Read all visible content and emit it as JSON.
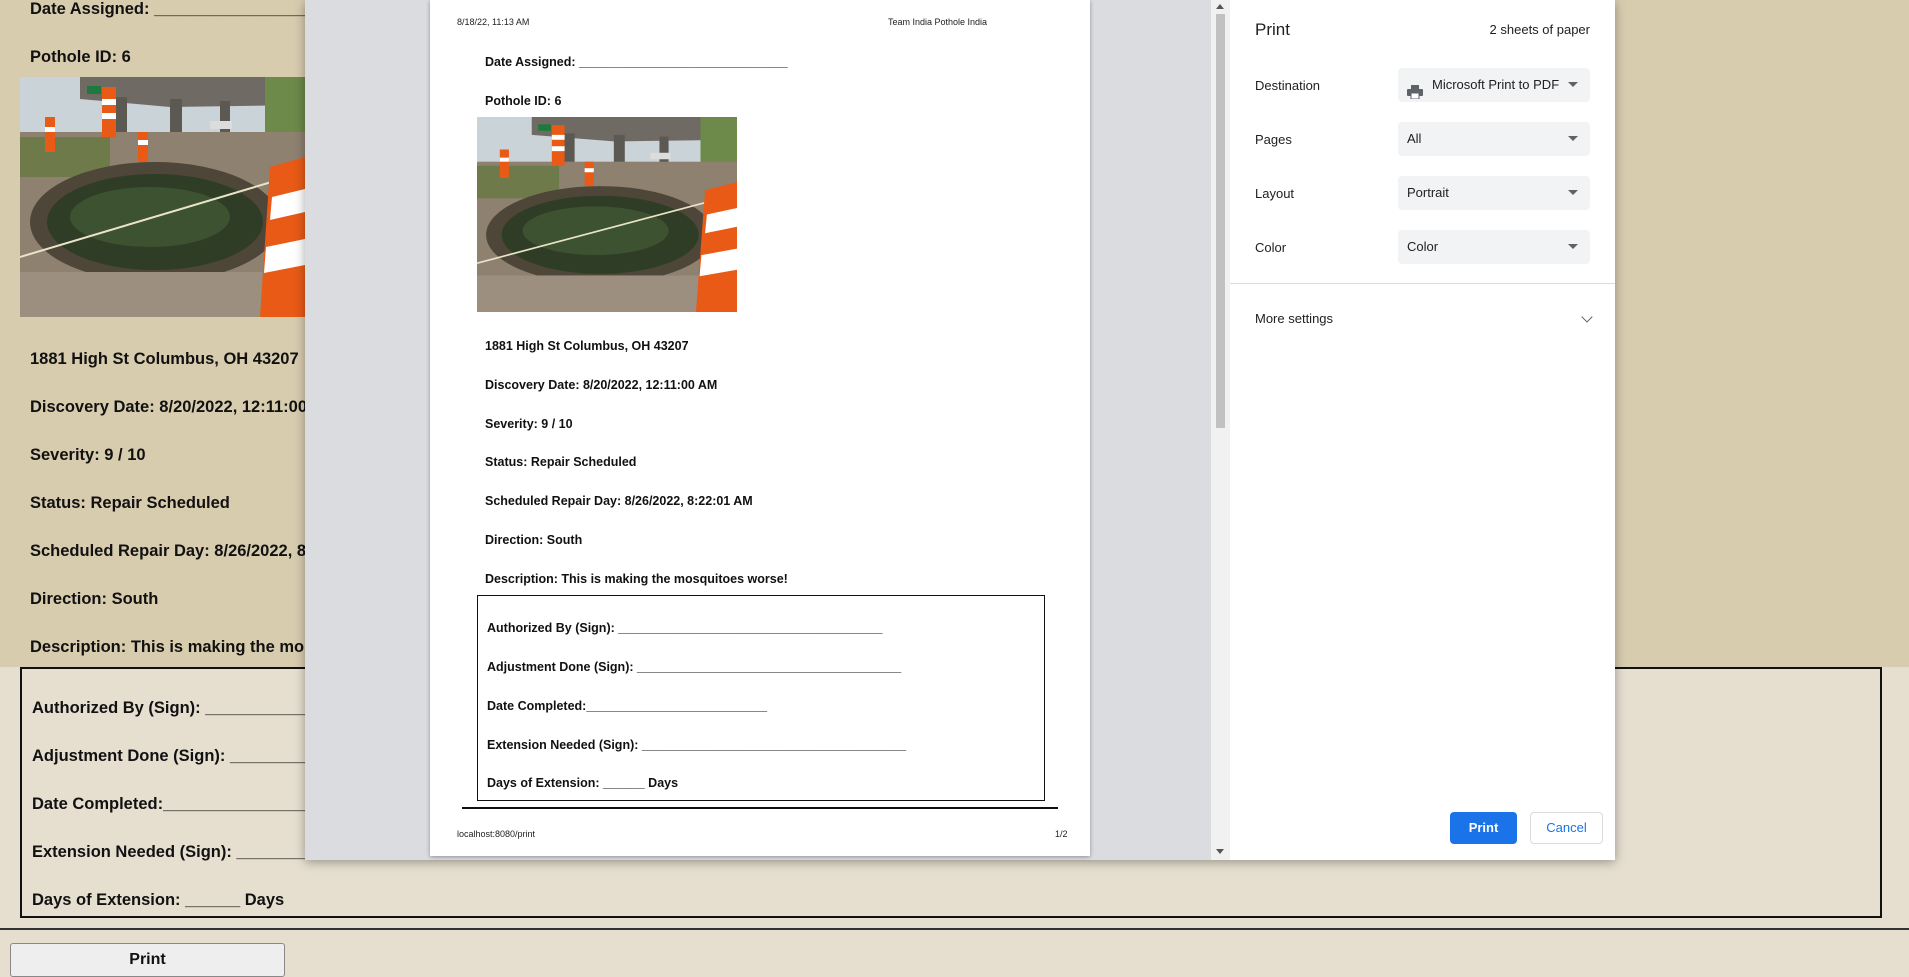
{
  "background_page": {
    "date_assigned": "Date Assigned: ______________________________",
    "pothole_id": "Pothole ID: 6",
    "address": "1881 High St Columbus, OH 43207",
    "discovery_date": "Discovery Date: 8/20/2022, 12:11:00 AM",
    "severity": "Severity: 9 / 10",
    "status": "Status: Repair Scheduled",
    "scheduled_repair": "Scheduled Repair Day: 8/26/2022, 8:22:01 AM",
    "direction": "Direction: South",
    "description": "Description: This is making the mosquitoes worse!",
    "authorized_by": "Authorized By (Sign): ______________________________________",
    "adjustment_done": "Adjustment Done (Sign): ______________________________________",
    "date_completed": "Date Completed:__________________________",
    "extension_needed": "Extension Needed (Sign): ______________________________________",
    "days_of_extension": "Days of Extension: ______ Days",
    "print_button": "Print"
  },
  "preview": {
    "header_left": "8/18/22, 11:13 AM",
    "header_center": "Team India Pothole India",
    "footer_left": "localhost:8080/print",
    "footer_right": "1/2",
    "date_assigned": "Date Assigned: ______________________________",
    "pothole_id": "Pothole ID: 6",
    "address": "1881 High St Columbus, OH 43207",
    "discovery_date": "Discovery Date: 8/20/2022, 12:11:00 AM",
    "severity": "Severity: 9 / 10",
    "status": "Status: Repair Scheduled",
    "scheduled_repair": "Scheduled Repair Day: 8/26/2022, 8:22:01 AM",
    "direction": "Direction: South",
    "description": "Description: This is making the mosquitoes worse!",
    "authorized_by": "Authorized By (Sign): ______________________________________",
    "adjustment_done": "Adjustment Done (Sign): ______________________________________",
    "date_completed": "Date Completed:__________________________",
    "extension_needed": "Extension Needed (Sign): ______________________________________",
    "days_of_extension": "Days of Extension: ______ Days"
  },
  "print_panel": {
    "title": "Print",
    "sheets": "2 sheets of paper",
    "destination_label": "Destination",
    "destination_value": "Microsoft Print to PDF",
    "destination_icon": "printer-icon",
    "pages_label": "Pages",
    "pages_value": "All",
    "layout_label": "Layout",
    "layout_value": "Portrait",
    "color_label": "Color",
    "color_value": "Color",
    "more_settings": "More settings",
    "print_button": "Print",
    "cancel_button": "Cancel",
    "accent_color": "#1a73e8"
  }
}
